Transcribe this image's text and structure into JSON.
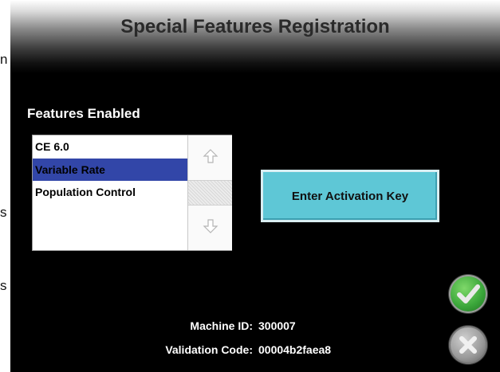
{
  "window": {
    "title": "Special Features Registration"
  },
  "left_edge": {
    "chars": [
      "n",
      "s",
      "s"
    ]
  },
  "features": {
    "label": "Features Enabled",
    "items": [
      {
        "label": "CE 6.0",
        "selected": false
      },
      {
        "label": "Variable Rate",
        "selected": true
      },
      {
        "label": "Population Control",
        "selected": false
      }
    ],
    "scroll_up_icon": "arrow-up-icon",
    "scroll_down_icon": "arrow-down-icon"
  },
  "activation": {
    "button_label": "Enter Activation Key"
  },
  "info": {
    "machine_id_label": "Machine ID:",
    "machine_id_value": "300007",
    "validation_code_label": "Validation Code:",
    "validation_code_value": "00004b2faea8"
  },
  "actions": {
    "ok_icon": "checkmark-icon",
    "cancel_icon": "x-icon"
  },
  "colors": {
    "selection": "#3246a8",
    "activate_button": "#5ec7d6",
    "ok": "#3aa63a",
    "cancel": "#9a9a9a"
  }
}
